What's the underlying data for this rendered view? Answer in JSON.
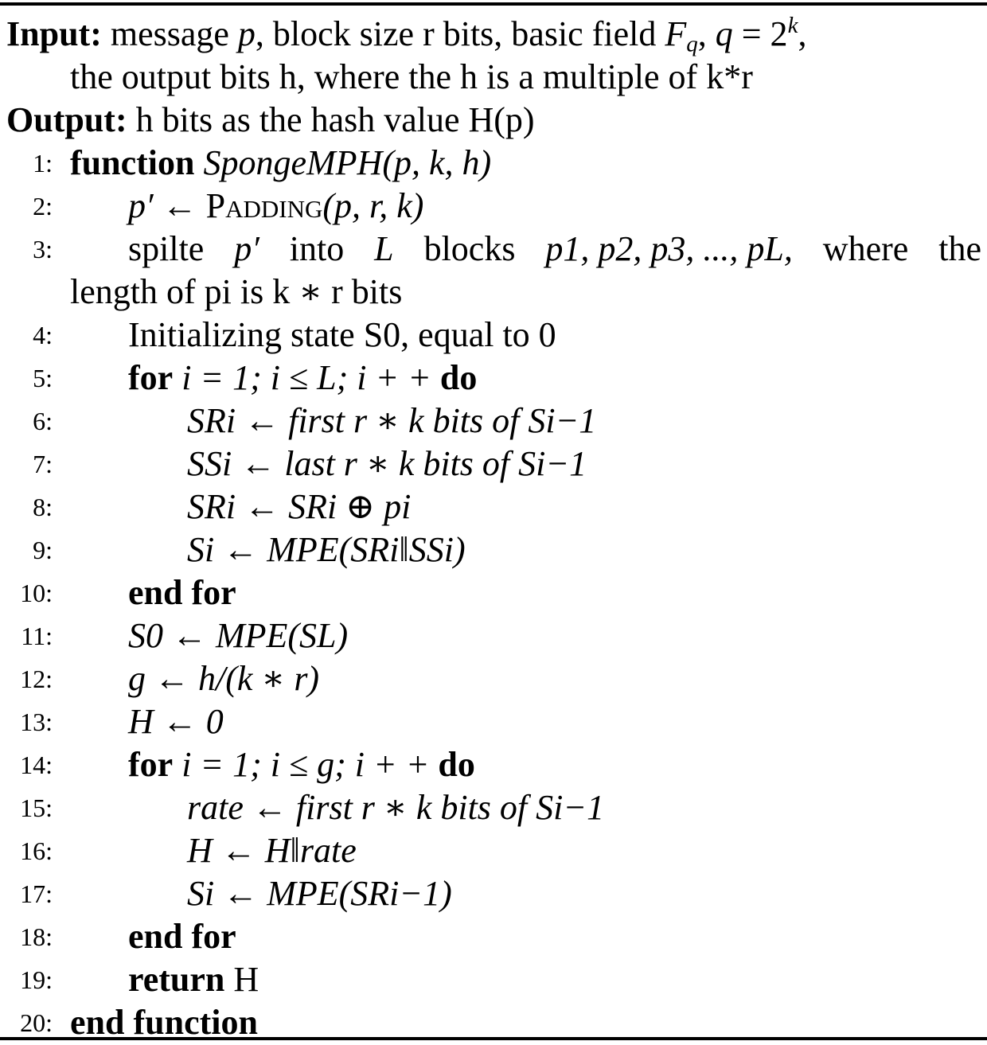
{
  "algorithm": {
    "input_label": "Input:",
    "input_text_1": "message ",
    "input_p": "p",
    "input_text_2": ", block size r bits, basic field ",
    "input_F": "F",
    "input_q_sub": "q",
    "input_text_3": ", ",
    "input_q": "q",
    "input_eq": " = 2",
    "input_k_sup": "k",
    "input_text_4": ",",
    "input_cont": "the output bits h, where the h is a multiple of k*r",
    "output_label": "Output:",
    "output_text": "h bits as the hash value H(p)",
    "lines": [
      {
        "num": "1:",
        "kw": "function",
        "text": "SpongeMPH(p, k, h)"
      },
      {
        "num": "2:",
        "text_m1": "p′ ← ",
        "sc": "Padding",
        "text_m2": "(p, r, k)"
      },
      {
        "num": "3:",
        "parts": [
          "spilte",
          "p′",
          "into",
          "L",
          "blocks",
          "p1, p2, p3, ..., pL,",
          "where",
          "the"
        ],
        "cont": "length of pi is k ∗ r bits"
      },
      {
        "num": "4:",
        "text": "Initializing state S0, equal to 0"
      },
      {
        "num": "5:",
        "kw": "for",
        "text": "i = 1; i ≤ L; i + +",
        "kw2": "do"
      },
      {
        "num": "6:",
        "text": "SRi ← first r ∗ k bits of Si−1"
      },
      {
        "num": "7:",
        "text": "SSi ← last r ∗ k bits of Si−1"
      },
      {
        "num": "8:",
        "text": "SRi ← SRi ⊕ pi"
      },
      {
        "num": "9:",
        "text": "Si ← MPE(SRi‖SSi)"
      },
      {
        "num": "10:",
        "kw": "end for"
      },
      {
        "num": "11:",
        "text": "S0 ← MPE(SL)"
      },
      {
        "num": "12:",
        "text": "g ← h/(k ∗ r)"
      },
      {
        "num": "13:",
        "text": "H ← 0"
      },
      {
        "num": "14:",
        "kw": "for",
        "text": "i = 1; i ≤ g; i + +",
        "kw2": "do"
      },
      {
        "num": "15:",
        "text": "rate ← first r ∗ k bits of Si−1"
      },
      {
        "num": "16:",
        "text": "H ← H‖rate"
      },
      {
        "num": "17:",
        "text": "Si ← MPE(SRi−1)"
      },
      {
        "num": "18:",
        "kw": "end for"
      },
      {
        "num": "19:",
        "kw": "return",
        "text": "H"
      },
      {
        "num": "20:",
        "kw": "end function"
      }
    ]
  }
}
